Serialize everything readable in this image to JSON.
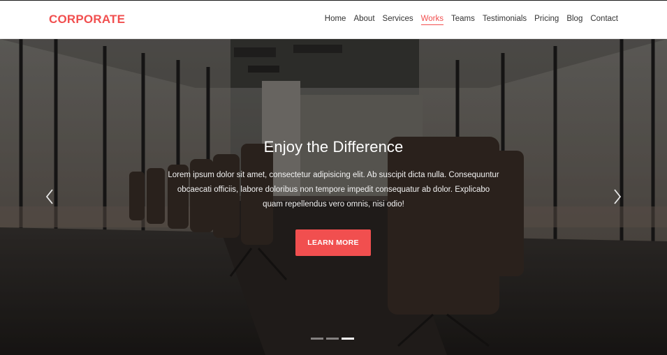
{
  "brand": {
    "name": "CORPORATE"
  },
  "nav": {
    "items": [
      {
        "label": "Home"
      },
      {
        "label": "About"
      },
      {
        "label": "Services"
      },
      {
        "label": "Works",
        "active": true
      },
      {
        "label": "Teams"
      },
      {
        "label": "Testimonials"
      },
      {
        "label": "Pricing"
      },
      {
        "label": "Blog"
      },
      {
        "label": "Contact"
      }
    ]
  },
  "hero": {
    "title": "Enjoy the Difference",
    "description": "Lorem ipsum dolor sit amet, consectetur adipisicing elit. Ab suscipit dicta nulla. Consequuntur obcaecati officiis, labore doloribus non tempore impedit consequatur ab dolor. Explicabo quam repellendus vero omnis, nisi odio!",
    "cta_label": "LEARN MORE",
    "background_image": "conference-room-photo",
    "slides_total": 3,
    "active_slide": 3
  },
  "icons": {
    "prev": "chevron-left-icon",
    "next": "chevron-right-icon"
  },
  "colors": {
    "accent": "#f14f4f",
    "text_dark": "#333333",
    "header_bg": "#ffffff"
  }
}
